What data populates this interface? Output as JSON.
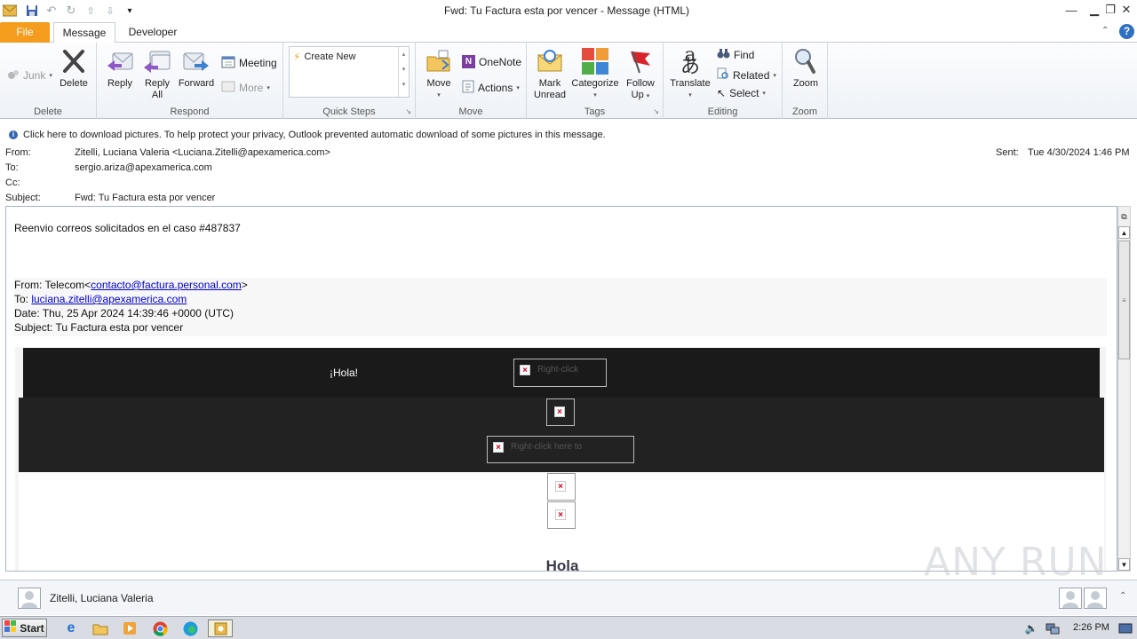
{
  "window": {
    "title": "Fwd: Tu Factura esta por vencer  -  Message (HTML)"
  },
  "tabs": [
    {
      "label": "File"
    },
    {
      "label": "Message"
    },
    {
      "label": "Developer"
    }
  ],
  "ribbon": {
    "delete_group": {
      "label": "Delete",
      "junk": "Junk",
      "delete": "Delete"
    },
    "respond_group": {
      "label": "Respond",
      "reply": "Reply",
      "reply_all_1": "Reply",
      "reply_all_2": "All",
      "forward": "Forward",
      "meeting": "Meeting",
      "more": "More"
    },
    "quicksteps_group": {
      "label": "Quick Steps",
      "create_new": "Create New"
    },
    "move_group": {
      "label": "Move",
      "move": "Move",
      "onenote": "OneNote",
      "actions": "Actions"
    },
    "tags_group": {
      "label": "Tags",
      "mark_unread_1": "Mark",
      "mark_unread_2": "Unread",
      "categorize": "Categorize",
      "follow_up_1": "Follow",
      "follow_up_2": "Up"
    },
    "editing_group": {
      "label": "Editing",
      "translate": "Translate",
      "find": "Find",
      "related": "Related",
      "select": "Select"
    },
    "zoom_group": {
      "label": "Zoom",
      "zoom": "Zoom"
    }
  },
  "infobar": {
    "text": "Click here to download pictures. To help protect your privacy, Outlook prevented automatic download of some pictures in this message."
  },
  "header": {
    "from_label": "From:",
    "from_value": "Zitelli, Luciana Valeria <Luciana.Zitelli@apexamerica.com>",
    "to_label": "To:",
    "to_value": "sergio.ariza@apexamerica.com",
    "cc_label": "Cc:",
    "subject_label": "Subject:",
    "subject_value": "Fwd: Tu Factura esta por vencer",
    "sent_label": "Sent:",
    "sent_value": "Tue 4/30/2024 1:46 PM"
  },
  "body": {
    "intro": "Reenvio correos solicitados en el caso #487837",
    "fwd_from_prefix": "From: Telecom<",
    "fwd_from_link": "contacto@factura.personal.com",
    "fwd_from_suffix": ">",
    "fwd_to_prefix": "To: ",
    "fwd_to_link": "luciana.zitelli@apexamerica.com",
    "fwd_date": "Date: Thu, 25 Apr 2024 14:39:46 +0000 (UTC)",
    "fwd_subject": "Subject: Tu Factura esta por vencer",
    "hola_small": "¡Hola!",
    "img_text_1": "Right-click",
    "img_text_2": "Right-click here to",
    "hola_big": "Hola"
  },
  "people_pane": {
    "name": "Zitelli, Luciana Valeria"
  },
  "taskbar": {
    "start": "Start",
    "clock": "2:26 PM"
  },
  "watermark": "ANY RUN",
  "colors": {
    "file_tab": "#f39c1e",
    "link": "#0000cc",
    "email_dark": "#1a1a1a"
  }
}
